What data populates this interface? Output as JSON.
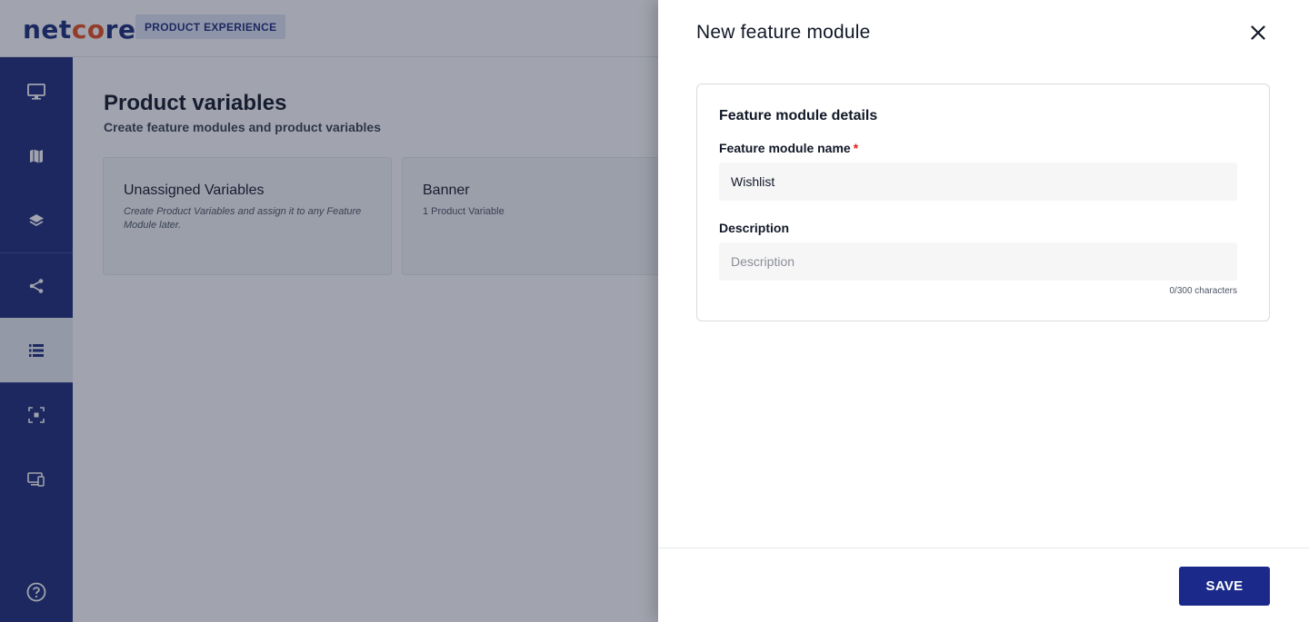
{
  "app": {
    "logo_prefix": "net",
    "logo_oo": "co",
    "logo_suffix": "re",
    "badge": "PRODUCT EXPERIENCE"
  },
  "sidebar": {
    "items": [
      {
        "icon": "monitor-icon"
      },
      {
        "icon": "map-icon"
      },
      {
        "icon": "layers-icon"
      },
      {
        "icon": "share-icon"
      },
      {
        "icon": "list-icon",
        "active": true
      },
      {
        "icon": "scan-icon"
      },
      {
        "icon": "devices-icon"
      },
      {
        "icon": "help-icon"
      }
    ]
  },
  "main": {
    "title": "Product variables",
    "subtitle": "Create feature modules and product variables",
    "cards": [
      {
        "title": "Unassigned Variables",
        "desc": "Create Product Variables and assign it to any Feature Module later."
      },
      {
        "title": "Banner",
        "desc": "1 Product Variable"
      }
    ]
  },
  "drawer": {
    "title": "New feature module",
    "section_title": "Feature module details",
    "name_label": "Feature module name",
    "required_mark": "*",
    "name_value": "Wishlist",
    "description_label": "Description",
    "description_placeholder": "Description",
    "char_count": "0/300 characters",
    "save_label": "SAVE"
  },
  "colors": {
    "brand_navy": "#1b2a78",
    "accent_orange": "#e84c1c",
    "required_red": "#e11d1d"
  }
}
